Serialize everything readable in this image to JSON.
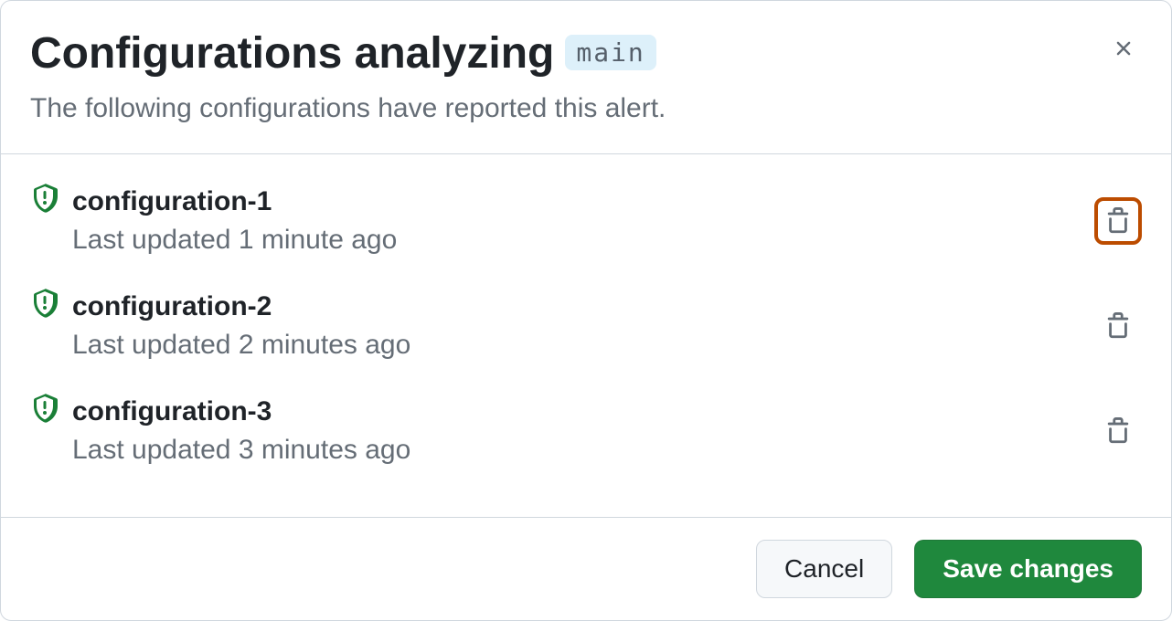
{
  "header": {
    "title": "Configurations analyzing",
    "branch": "main",
    "subtitle": "The following configurations have reported this alert."
  },
  "configs": [
    {
      "name": "configuration-1",
      "updated": "Last updated 1 minute ago",
      "highlighted": true
    },
    {
      "name": "configuration-2",
      "updated": "Last updated 2 minutes ago",
      "highlighted": false
    },
    {
      "name": "configuration-3",
      "updated": "Last updated 3 minutes ago",
      "highlighted": false
    }
  ],
  "footer": {
    "cancel": "Cancel",
    "save": "Save changes"
  },
  "colors": {
    "shield": "#1a7f37",
    "highlight": "#bc4c00"
  }
}
